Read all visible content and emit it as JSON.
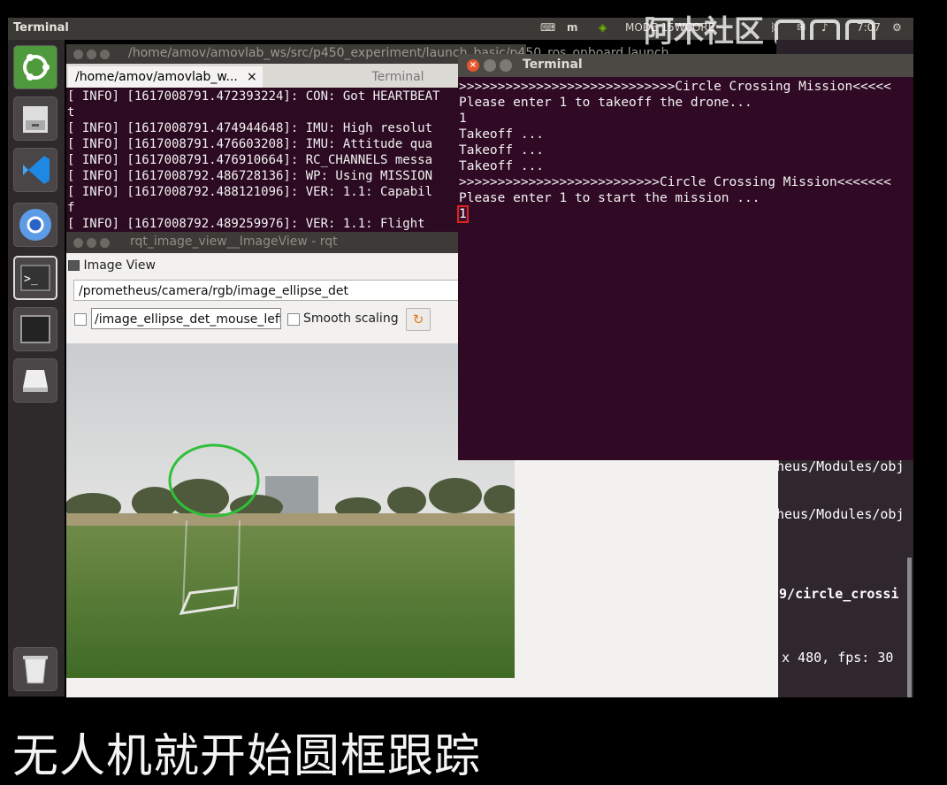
{
  "top_panel": {
    "app_title": "Terminal",
    "tray_text": "MODE 15WCORE",
    "clock": "7:07"
  },
  "watermark": {
    "text": "阿木社区",
    "logo_text": "bilibili"
  },
  "back_terminal": {
    "window_title": "/home/amov/amovlab_ws/src/p450_experiment/launch_basic/p450_ros_onboard.launch",
    "tabs": [
      "/home/amov/amovlab_w...",
      "Terminal"
    ],
    "lines": [
      "[ INFO] [1617008791.472393224]: CON: Got HEARTBEAT",
      "t",
      "[ INFO] [1617008791.474944648]: IMU: High resolut",
      "[ INFO] [1617008791.476603208]: IMU: Attitude qua",
      "[ INFO] [1617008791.476910664]: RC_CHANNELS messa",
      "[ INFO] [1617008792.486728136]: WP: Using MISSION",
      "[ INFO] [1617008792.488121096]: VER: 1.1: Capabil",
      "f",
      "[ INFO] [1617008792.489259976]: VER: 1.1: Flight"
    ]
  },
  "background_terminal_lines": [
    "heus/Modules/obj",
    "heus/Modules/obj",
    "89/circle_crossi",
    "x 480, fps: 30"
  ],
  "rqt": {
    "window_title": "rqt_image_view__ImageView - rqt",
    "plugin_label": "Image View",
    "topic": "/prometheus/camera/rgb/image_ellipse_det",
    "mouse_topic": "/image_ellipse_det_mouse_left",
    "smooth_scaling_label": "Smooth scaling"
  },
  "front_terminal": {
    "window_title": "Terminal",
    "lines": [
      ">>>>>>>>>>>>>>>>>>>>>>>>>>>>Circle Crossing Mission<<<<<",
      "Please enter 1 to takeoff the drone...",
      "1",
      "Takeoff ...",
      "Takeoff ...",
      "Takeoff ...",
      ">>>>>>>>>>>>>>>>>>>>>>>>>>Circle Crossing Mission<<<<<<<",
      "Please enter 1 to start the mission ..."
    ],
    "input_value": "1"
  },
  "subtitle": "无人机就开始圆框跟踪",
  "colors": {
    "terminal_bg": "#300a24",
    "panel_bg": "#3b3a36",
    "detection_circle": "#2fbf3a"
  }
}
